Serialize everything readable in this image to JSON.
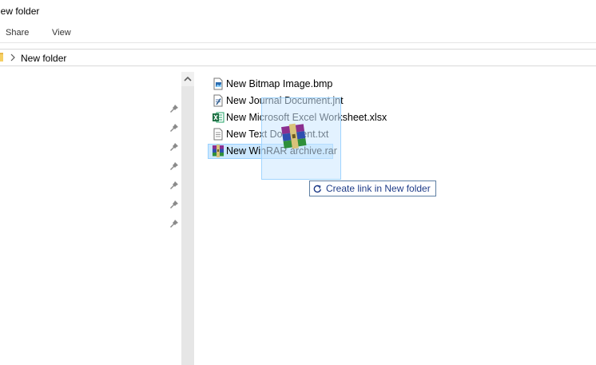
{
  "window": {
    "title": "New folder"
  },
  "ribbon": {
    "tabs": [
      {
        "label": "Share"
      },
      {
        "label": "View"
      }
    ]
  },
  "address": {
    "crumb": "New folder"
  },
  "files": [
    {
      "name": "New Bitmap Image.bmp",
      "icon": "bitmap-file-icon"
    },
    {
      "name": "New Journal Document.jnt",
      "icon": "journal-file-icon"
    },
    {
      "name": "New Microsoft Excel Worksheet.xlsx",
      "icon": "excel-file-icon"
    },
    {
      "name": "New Text Document.txt",
      "icon": "text-file-icon"
    },
    {
      "name": "New WinRAR archive.rar",
      "icon": "winrar-archive-icon",
      "selected": true
    }
  ],
  "drag": {
    "tooltip": "Create link in New folder",
    "icon": "link-arrow-icon"
  },
  "colors": {
    "selection": "#cce8ff",
    "selection_border": "#99d1ff",
    "tooltip_text": "#1f3c88"
  }
}
